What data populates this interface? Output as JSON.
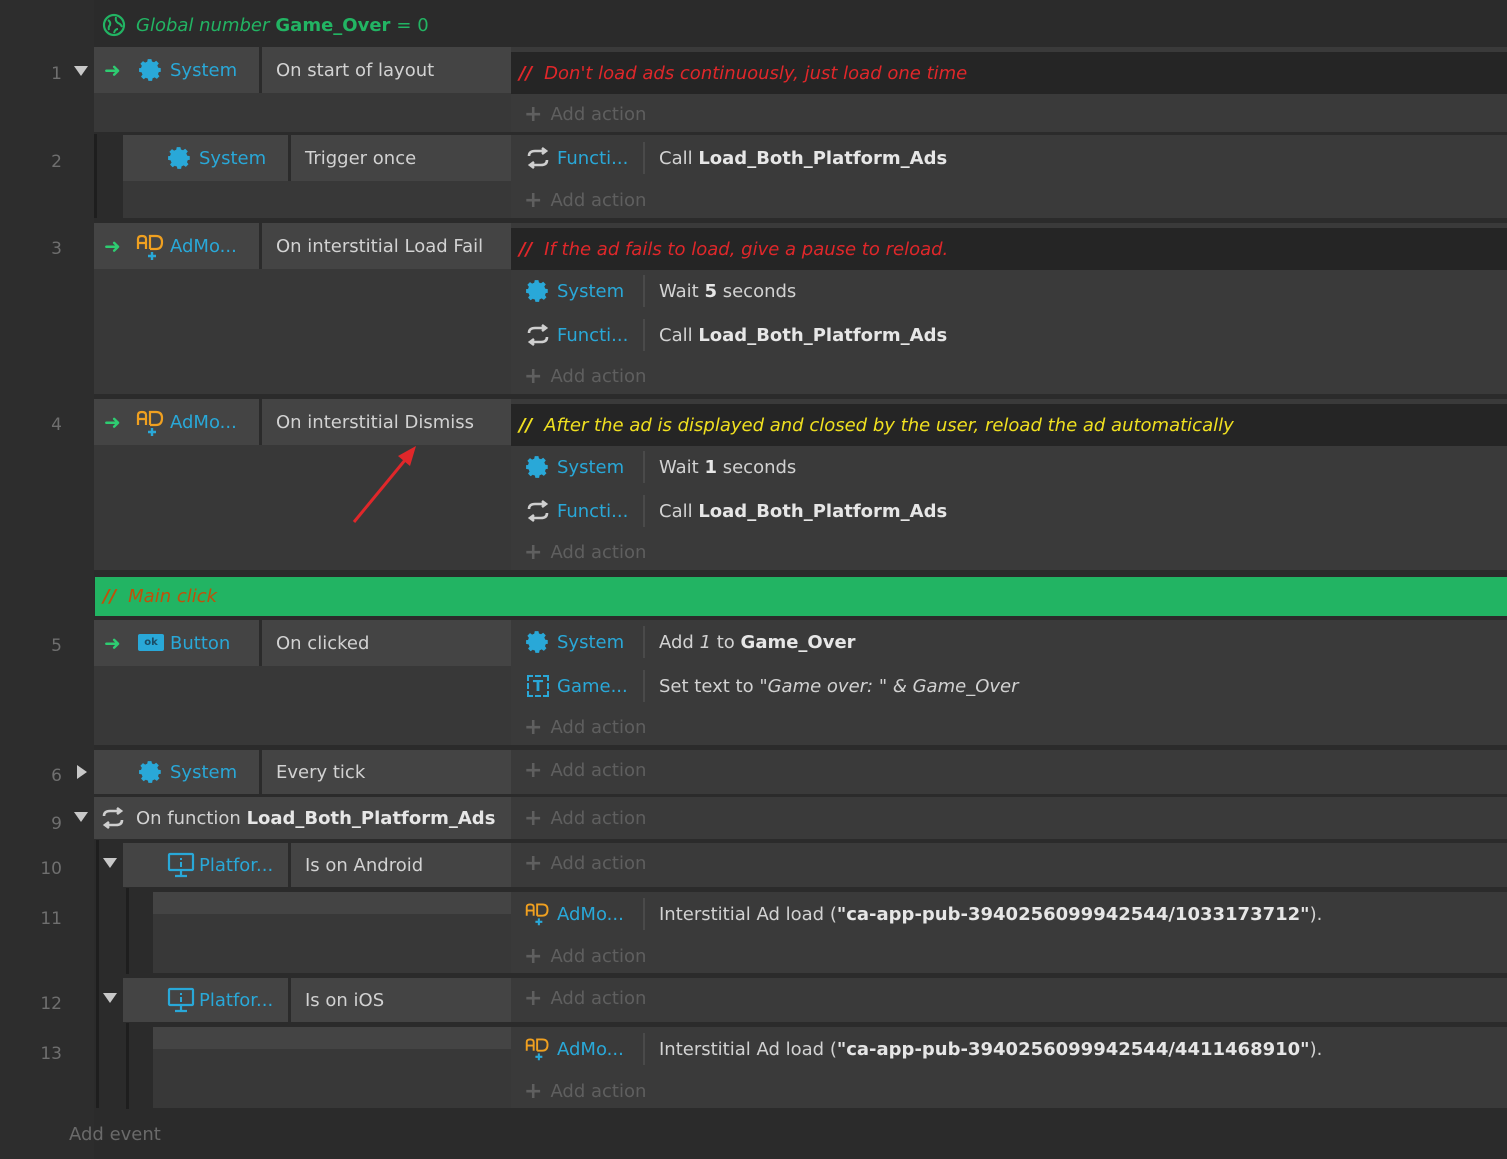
{
  "global_var": {
    "prefix": "Global number",
    "name": "Game_Over",
    "value": "= 0"
  },
  "colors": {
    "accent_green": "#22b463",
    "object_blue": "#29a8d8",
    "comment_red": "#e0272a",
    "comment_yellow": "#f0e020",
    "comment_orange": "#c0500a"
  },
  "events": {
    "e1": {
      "num": "1",
      "obj": "System",
      "cond": "On start of layout",
      "comment": "Don't load ads continuously, just load one time",
      "add_action": "Add action"
    },
    "e2": {
      "num": "2",
      "obj": "System",
      "cond": "Trigger once",
      "actions": [
        {
          "obj": "Functi...",
          "pre": "Call ",
          "bold": "Load_Both_Platform_Ads"
        }
      ],
      "add_action": "Add action"
    },
    "e3": {
      "num": "3",
      "obj": "AdMo...",
      "cond": "On interstitial Load Fail",
      "comment": "If the ad fails to load, give a pause to reload.",
      "actions": [
        {
          "obj": "System",
          "pre": "Wait ",
          "bold": "5",
          "post": " seconds"
        },
        {
          "obj": "Functi...",
          "pre": "Call ",
          "bold": "Load_Both_Platform_Ads"
        }
      ],
      "add_action": "Add action"
    },
    "e4": {
      "num": "4",
      "obj": "AdMo...",
      "cond": "On interstitial Dismiss",
      "comment": "After the ad is displayed and closed by the user, reload the ad automatically",
      "actions": [
        {
          "obj": "System",
          "pre": "Wait ",
          "bold": "1",
          "post": " seconds"
        },
        {
          "obj": "Functi...",
          "pre": "Call ",
          "bold": "Load_Both_Platform_Ads"
        }
      ],
      "add_action": "Add action"
    },
    "comment_main": "Main click",
    "e5": {
      "num": "5",
      "obj": "Button",
      "cond": "On clicked",
      "actions": [
        {
          "obj": "System",
          "pre": "Add ",
          "ital": "1",
          "mid": " to ",
          "bold": "Game_Over"
        },
        {
          "obj": "Game...",
          "pre": "Set text to ",
          "ital2": "\"Game over: \" & Game_Over"
        }
      ],
      "add_action": "Add action"
    },
    "e6": {
      "num": "6",
      "obj": "System",
      "cond": "Every tick",
      "add_action": "Add action"
    },
    "e9": {
      "num": "9",
      "pre": "On function ",
      "bold": "Load_Both_Platform_Ads",
      "add_action": "Add action"
    },
    "e10": {
      "num": "10",
      "obj": "Platfor...",
      "cond": "Is on Android",
      "add_action": "Add action"
    },
    "e11": {
      "num": "11",
      "act_obj": "AdMo...",
      "pre": "Interstitial Ad load (",
      "bold": "\"ca-app-pub-3940256099942544/1033173712\"",
      "post": ").",
      "add_action": "Add action"
    },
    "e12": {
      "num": "12",
      "obj": "Platfor...",
      "cond": "Is on iOS",
      "add_action": "Add action"
    },
    "e13": {
      "num": "13",
      "act_obj": "AdMo...",
      "pre": "Interstitial Ad load (",
      "bold": "\"ca-app-pub-3940256099942544/4411468910\"",
      "post": ").",
      "add_action": "Add action"
    }
  },
  "add_event": "Add event",
  "comment_prefix": "//"
}
